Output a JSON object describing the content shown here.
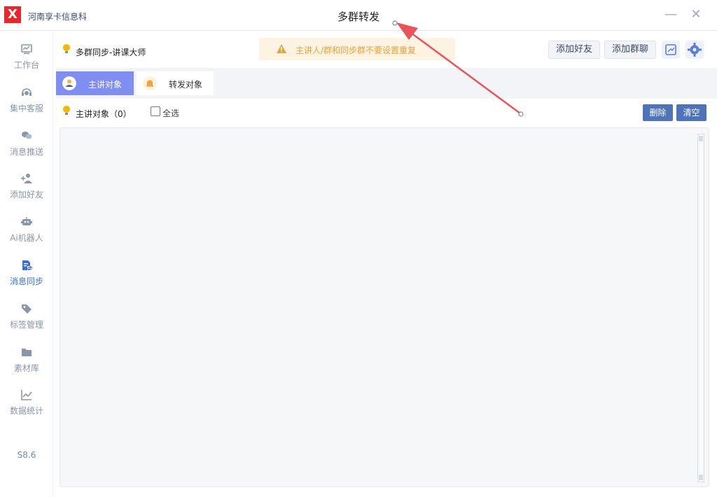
{
  "app": {
    "logo_text": "X",
    "company": "河南享卡信息科",
    "window_title": "多群转发",
    "minimize_glyph": "—",
    "close_glyph": "✕"
  },
  "sidebar": {
    "items": [
      {
        "label": "工作台",
        "icon": "monitor-icon"
      },
      {
        "label": "集中客服",
        "icon": "headset-icon"
      },
      {
        "label": "消息推送",
        "icon": "chat-bubbles-icon"
      },
      {
        "label": "添加好友",
        "icon": "add-user-icon"
      },
      {
        "label": "Ai机器人",
        "icon": "robot-icon"
      },
      {
        "label": "消息同步",
        "icon": "doc-sync-icon"
      },
      {
        "label": "标签管理",
        "icon": "tag-icon"
      },
      {
        "label": "素材库",
        "icon": "folder-icon"
      },
      {
        "label": "数据统计",
        "icon": "line-chart-icon"
      }
    ],
    "active_index": 5,
    "version": "S8.6"
  },
  "topbar": {
    "sync_title": "多群同步-讲课大师",
    "notice": "主讲人/群和同步群不要设置重复",
    "add_friend": "添加好友",
    "add_group": "添加群聊"
  },
  "tabs": [
    {
      "label": "主讲对象",
      "icon": "speaker-avatar-icon"
    },
    {
      "label": "转发对象",
      "icon": "bell-icon"
    }
  ],
  "list": {
    "title": "主讲对象（0）",
    "select_all": "全选",
    "delete": "删除",
    "clear": "清空"
  },
  "colors": {
    "accent": "#7f8ef0",
    "primary_button": "#4f73b8",
    "active_nav": "#3a6fd6",
    "warning": "#e6a23c",
    "annotation_arrow": "#e8545a"
  }
}
